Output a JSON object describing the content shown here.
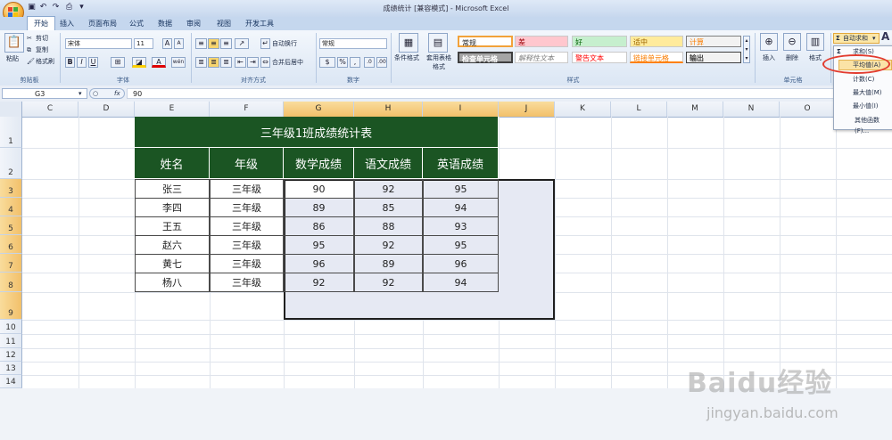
{
  "window": {
    "title": "成绩统计 [兼容模式] - Microsoft Excel"
  },
  "tabs": [
    "开始",
    "插入",
    "页面布局",
    "公式",
    "数据",
    "审阅",
    "视图",
    "开发工具"
  ],
  "ribbon": {
    "clipboard": {
      "paste": "粘贴",
      "cut": "剪切",
      "copy": "复制",
      "format_painter": "格式刷",
      "label": "剪贴板"
    },
    "font": {
      "name": "宋体",
      "size": "11",
      "bold": "B",
      "italic": "I",
      "underline": "U",
      "grow": "A",
      "shrink": "A",
      "wen": "wén",
      "label": "字体"
    },
    "alignment": {
      "wrap": "自动换行",
      "merge": "合并后居中",
      "label": "对齐方式"
    },
    "number": {
      "format": "常规",
      "label": "数字"
    },
    "styles": {
      "conditional": "条件格式",
      "table": "套用表格格式",
      "cells": [
        "常规",
        "差",
        "好",
        "适中",
        "计算",
        "检查单元格",
        "解释性文本",
        "警告文本",
        "链接单元格",
        "输出"
      ],
      "label": "样式"
    },
    "cells_group": {
      "insert": "插入",
      "delete": "删除",
      "format": "格式",
      "label": "单元格"
    },
    "editing": {
      "autosum": "自动求和"
    }
  },
  "formula_bar": {
    "name_box": "G3",
    "value": "90"
  },
  "columns": [
    "C",
    "D",
    "E",
    "F",
    "G",
    "H",
    "I",
    "J",
    "K",
    "L",
    "M",
    "N",
    "O"
  ],
  "rows": [
    "1",
    "2",
    "3",
    "4",
    "5",
    "6",
    "7",
    "8",
    "9",
    "10",
    "11",
    "12",
    "13",
    "14"
  ],
  "sheet": {
    "title": "三年级1班成绩统计表",
    "headers": [
      "姓名",
      "年级",
      "数学成绩",
      "语文成绩",
      "英语成绩"
    ],
    "data": [
      [
        "张三",
        "三年级",
        "90",
        "92",
        "95"
      ],
      [
        "李四",
        "三年级",
        "89",
        "85",
        "94"
      ],
      [
        "王五",
        "三年级",
        "86",
        "88",
        "93"
      ],
      [
        "赵六",
        "三年级",
        "95",
        "92",
        "95"
      ],
      [
        "黄七",
        "三年级",
        "96",
        "89",
        "96"
      ],
      [
        "杨八",
        "三年级",
        "92",
        "92",
        "94"
      ]
    ]
  },
  "autosum_menu": {
    "items": [
      "求和(S)",
      "平均值(A)",
      "计数(C)",
      "最大值(M)",
      "最小值(I)",
      "其他函数(F)..."
    ],
    "highlighted": "平均值(A)"
  },
  "watermark": {
    "brand": "Baidu经验",
    "url": "jingyan.baidu.com"
  }
}
